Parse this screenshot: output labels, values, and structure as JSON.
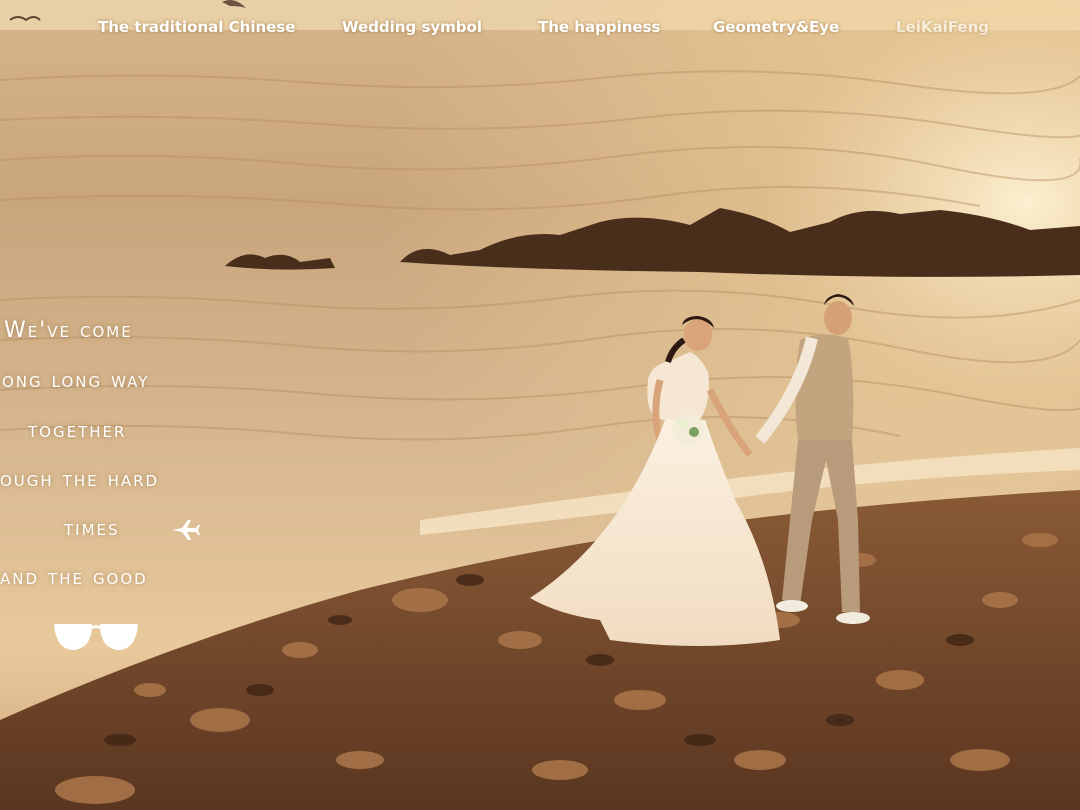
{
  "nav": {
    "items": [
      "The traditional Chinese",
      "Wedding symbol",
      "The happiness",
      "Geometry&Eye",
      "LeiKaiFeng"
    ]
  },
  "overlay": {
    "lines": [
      "We've come",
      "ong long way",
      "together",
      "ough the hard",
      "times",
      "and the good"
    ],
    "plane_icon": "airplane-icon",
    "glasses_icon": "sunglasses-icon"
  },
  "colors": {
    "accent": "#f3c98a",
    "text": "#ffffff"
  }
}
